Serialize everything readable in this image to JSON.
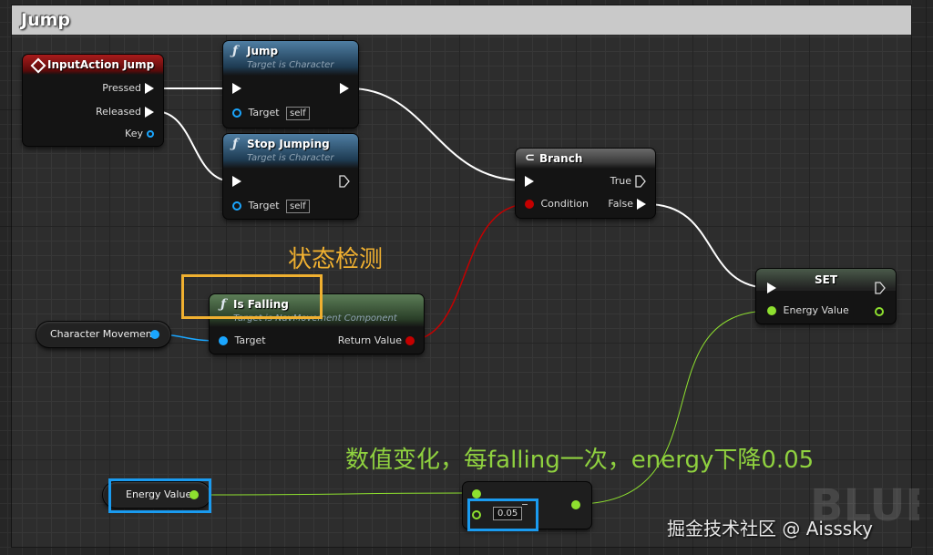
{
  "comment": {
    "title": "Jump"
  },
  "nodes": {
    "input_action": {
      "title": "InputAction Jump",
      "pins": {
        "pressed": "Pressed",
        "released": "Released",
        "key": "Key"
      }
    },
    "jump": {
      "title": "Jump",
      "subtitle": "Target is Character",
      "target_label": "Target",
      "target_value": "self"
    },
    "stop_jumping": {
      "title": "Stop Jumping",
      "subtitle": "Target is Character",
      "target_label": "Target",
      "target_value": "self"
    },
    "branch": {
      "title": "Branch",
      "true_label": "True",
      "false_label": "False",
      "condition_label": "Condition"
    },
    "is_falling": {
      "title": "Is Falling",
      "subtitle": "Target is NavMovement Component",
      "target_label": "Target",
      "return_label": "Return Value"
    },
    "character_movement": {
      "label": "Character Movement"
    },
    "set": {
      "title": "SET",
      "energy_label": "Energy Value"
    },
    "energy_get": {
      "label": "Energy Value"
    },
    "subtract": {
      "value": "0.05"
    }
  },
  "annotations": {
    "state_check": "状态检测",
    "value_change": "数值变化，每falling一次，energy下降0.05",
    "watermark": "BLUEP",
    "credit": "掘金技术社区 @ Aisssky"
  },
  "colors": {
    "exec_wire": "#ffffff",
    "bool_wire": "#c40000",
    "float_wire": "#8ee02f",
    "object_wire": "#1aa6ff",
    "annotation_orange": "#f0b030",
    "annotation_green": "#8fd13f",
    "highlight_blue": "#1a9bf0"
  },
  "icons": {
    "event": "diamond-event-icon",
    "function": "function-f-icon",
    "branch": "branch-icon"
  }
}
